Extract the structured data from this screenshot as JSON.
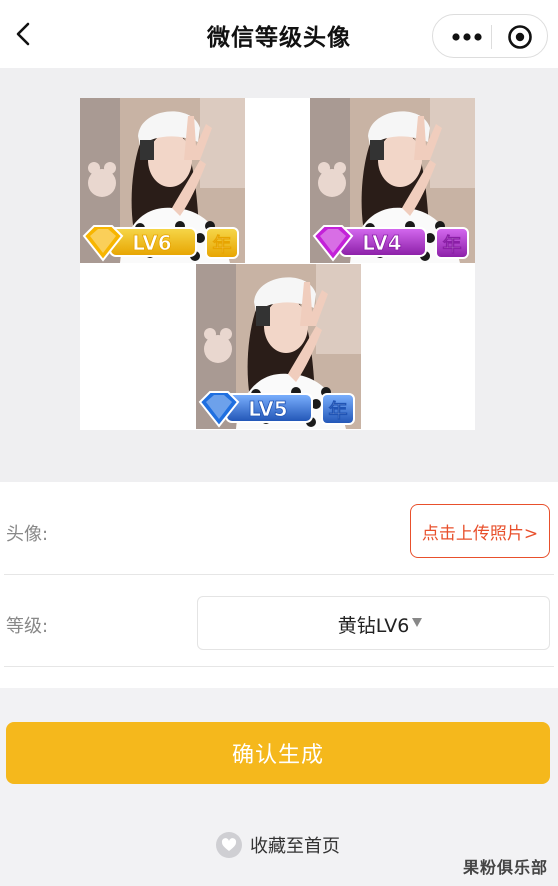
{
  "nav": {
    "title": "微信等级头像"
  },
  "preview": {
    "badges": [
      {
        "level_text": "LV6",
        "year_text": "年",
        "gem_color": "#f7b500",
        "badge_color": "#f6d74a",
        "badge_dark": "#e7a400"
      },
      {
        "level_text": "LV4",
        "year_text": "年",
        "gem_color": "#c321d8",
        "badge_color": "#d56af0",
        "badge_dark": "#8a1ea6"
      },
      {
        "level_text": "LV5",
        "year_text": "年",
        "gem_color": "#1f6fe0",
        "badge_color": "#7cb1ff",
        "badge_dark": "#2054b5"
      }
    ]
  },
  "form": {
    "avatar_label": "头像:",
    "upload_button": "点击上传照片>",
    "level_label": "等级:",
    "level_value": "黄钻LV6"
  },
  "confirm_button": "确认生成",
  "favorite_text": "收藏至首页",
  "watermark": "果粉俱乐部"
}
